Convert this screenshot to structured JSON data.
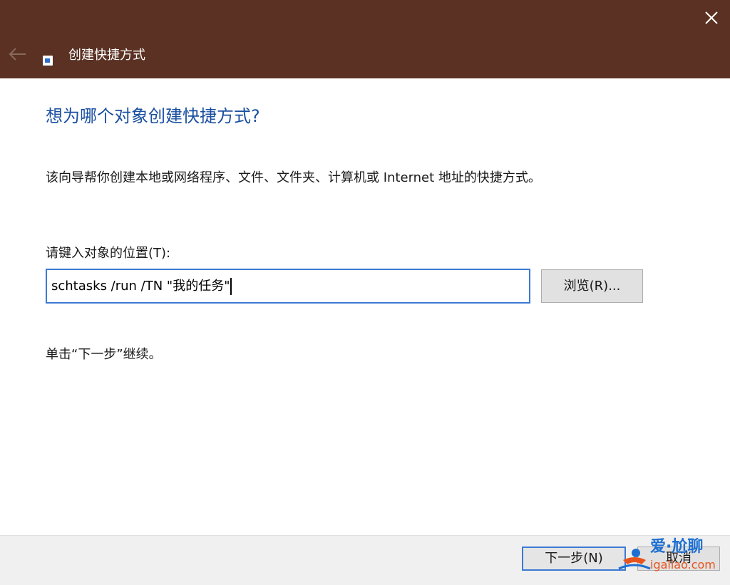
{
  "window": {
    "title": "创建快捷方式",
    "close_icon": "close-icon",
    "back_icon": "back-arrow-icon",
    "app_icon": "shortcut-icon",
    "titlebar_color": "#5a3122"
  },
  "content": {
    "heading": "想为哪个对象创建快捷方式?",
    "description": "该向导帮你创建本地或网络程序、文件、文件夹、计算机或 Internet 地址的快捷方式。",
    "field_label": "请键入对象的位置(T):",
    "location_value": "schtasks /run /TN \"我的任务\"",
    "browse_label": "浏览(R)...",
    "hint": "单击“下一步”继续。"
  },
  "footer": {
    "next_label": "下一步(N)",
    "cancel_label": "取消"
  },
  "watermark": {
    "title": "爱·尬聊",
    "url": "igaliao.com"
  },
  "colors": {
    "accent": "#3b7ad3",
    "heading": "#1a4fa0"
  }
}
